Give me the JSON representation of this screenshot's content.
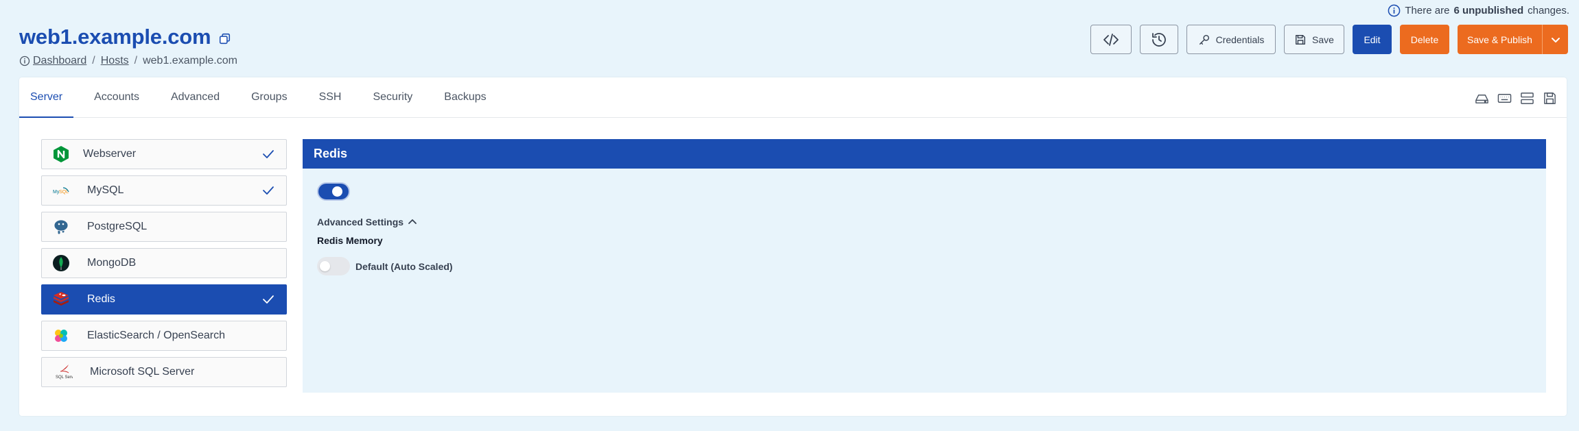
{
  "notice": {
    "prefix": "There are",
    "count_text": "6 unpublished",
    "suffix": "changes."
  },
  "header": {
    "title": "web1.example.com",
    "breadcrumb": [
      "Dashboard",
      "Hosts",
      "web1.example.com"
    ],
    "separator": "/"
  },
  "toolbar": {
    "code_icon": "code-icon",
    "history_icon": "history-icon",
    "credentials_label": "Credentials",
    "save_label": "Save",
    "edit_label": "Edit",
    "delete_label": "Delete",
    "publish_label": "Save & Publish"
  },
  "tabs": [
    {
      "label": "Server",
      "active": true
    },
    {
      "label": "Accounts"
    },
    {
      "label": "Advanced"
    },
    {
      "label": "Groups"
    },
    {
      "label": "SSH"
    },
    {
      "label": "Security"
    },
    {
      "label": "Backups"
    }
  ],
  "tab_tools": [
    "drive-icon",
    "keyboard-icon",
    "server-icon",
    "save-icon"
  ],
  "services": [
    {
      "label": "Webserver",
      "icon": "nginx-icon",
      "checked": true
    },
    {
      "label": "MySQL",
      "icon": "mysql-icon",
      "checked": true
    },
    {
      "label": "PostgreSQL",
      "icon": "postgresql-icon",
      "checked": false
    },
    {
      "label": "MongoDB",
      "icon": "mongodb-icon",
      "checked": false
    },
    {
      "label": "Redis",
      "icon": "redis-icon",
      "checked": true,
      "active": true
    },
    {
      "label": "ElasticSearch / OpenSearch",
      "icon": "elasticsearch-icon",
      "checked": false
    },
    {
      "label": "Microsoft SQL Server",
      "icon": "sqlserver-icon",
      "checked": false
    }
  ],
  "panel": {
    "title": "Redis",
    "enabled": true,
    "advanced_settings_label": "Advanced Settings",
    "redis_memory_label": "Redis Memory",
    "default_label": "Default (Auto Scaled)",
    "default_enabled": false
  },
  "colors": {
    "primary": "#1b4db1",
    "accent": "#ec6b1f",
    "background": "#e8f4fb"
  }
}
